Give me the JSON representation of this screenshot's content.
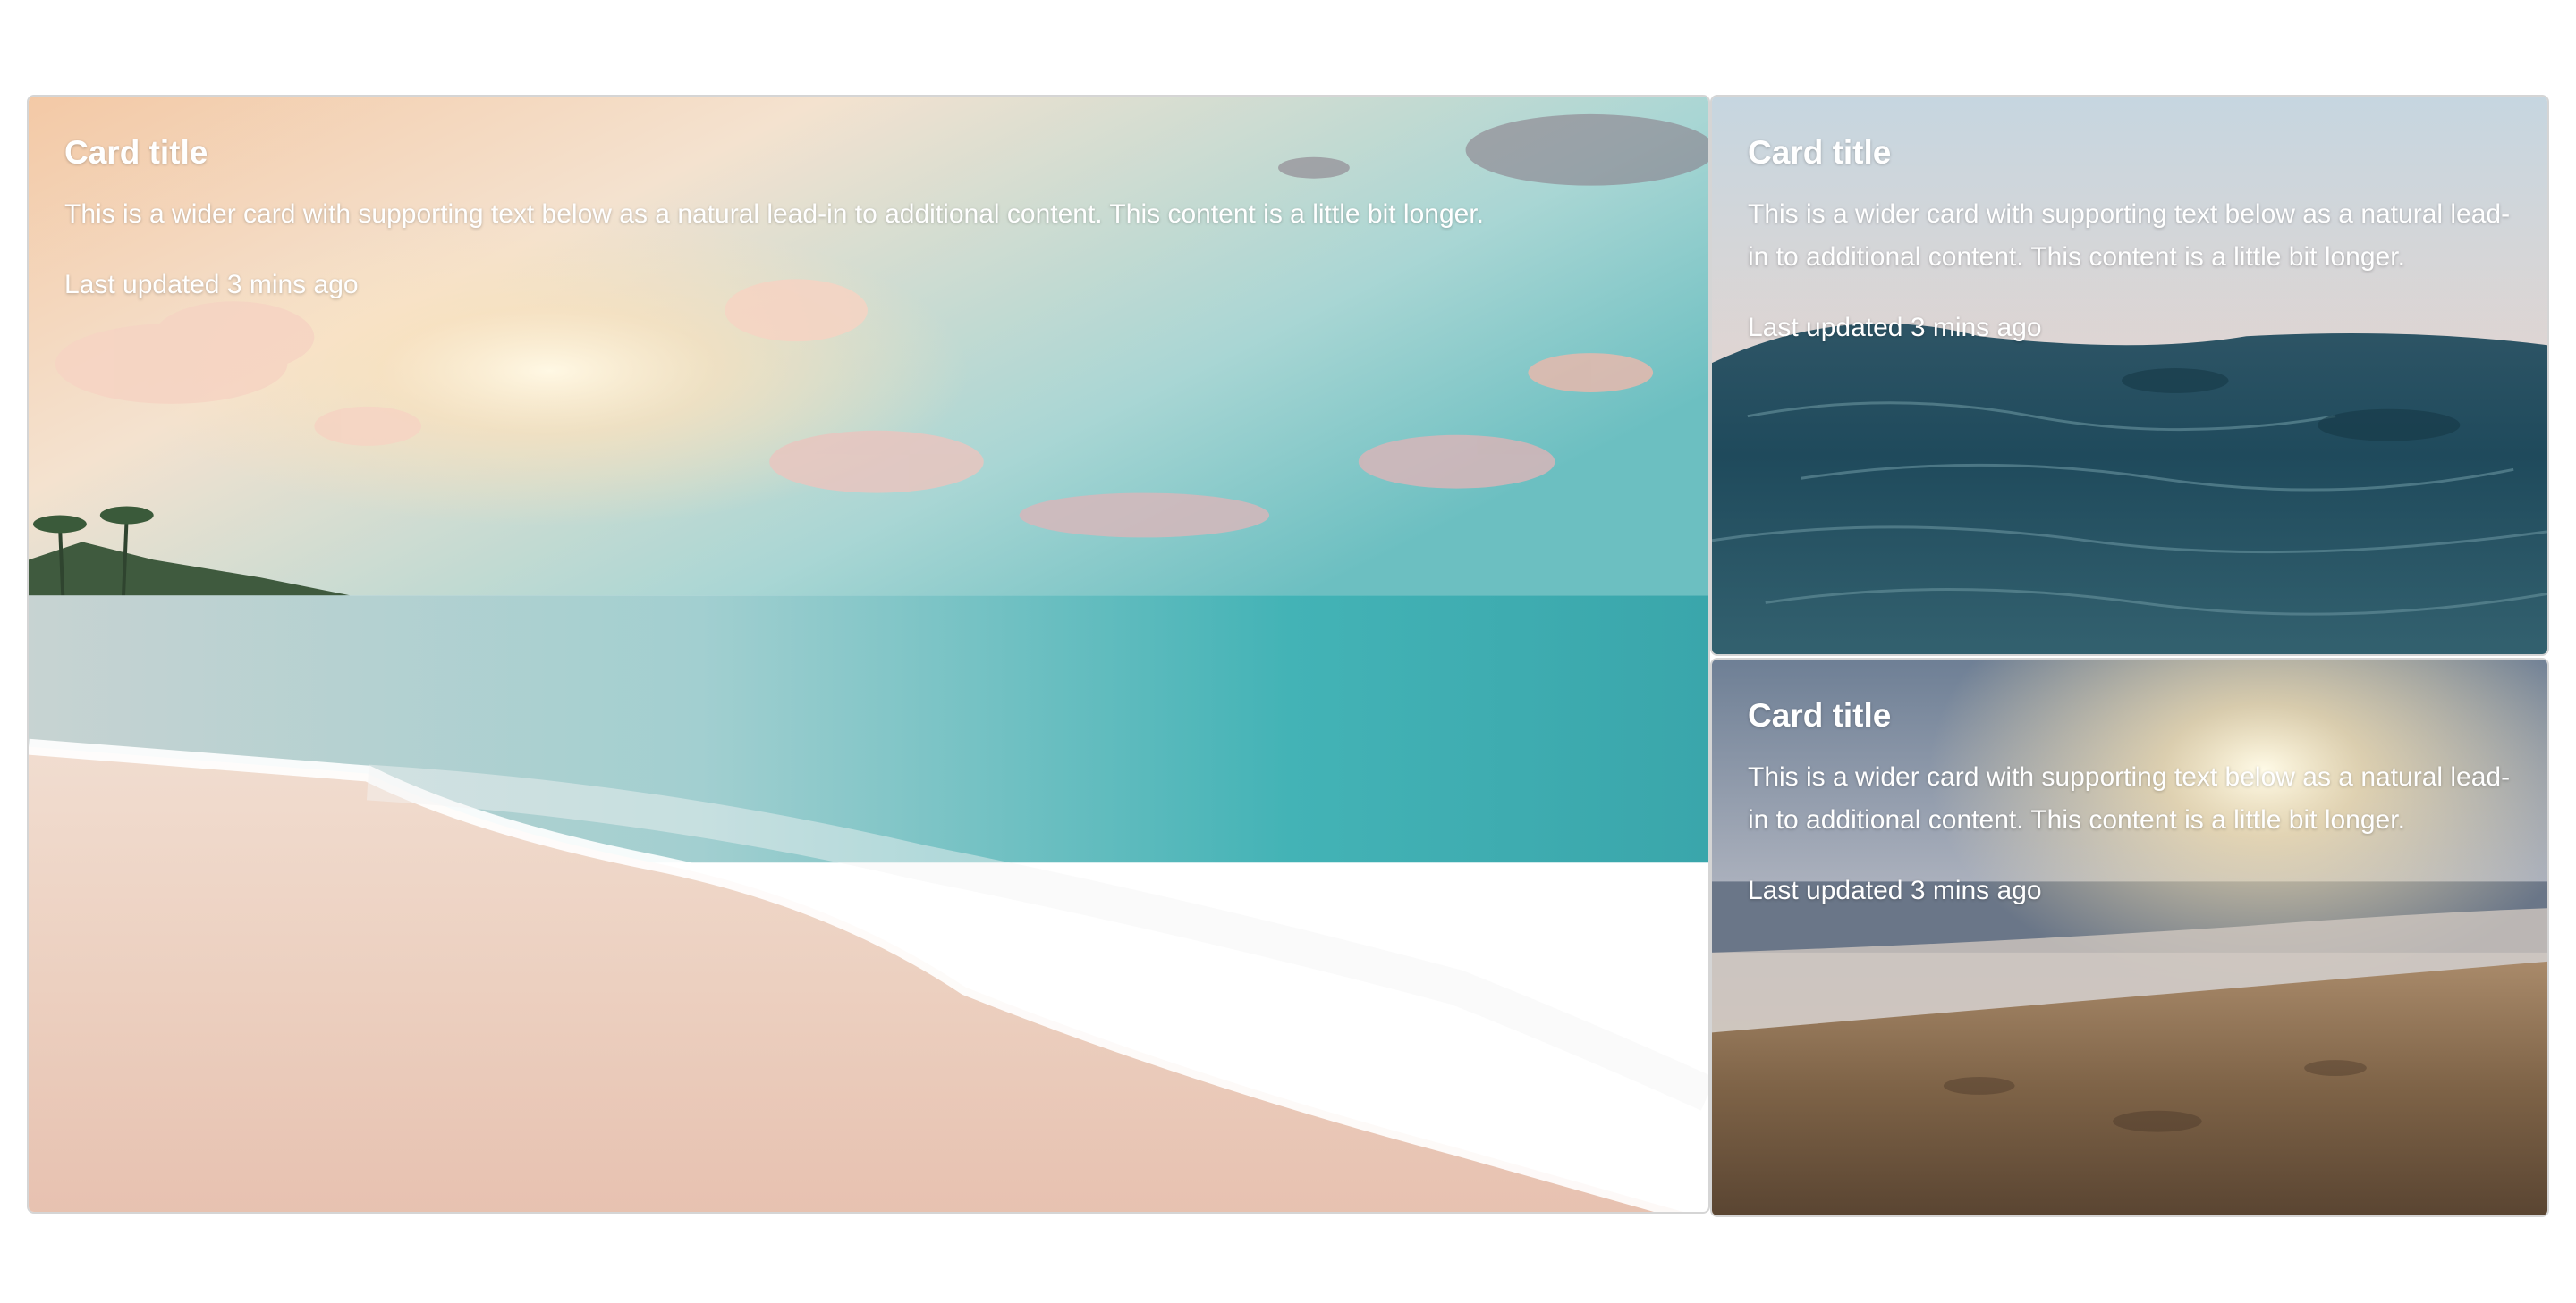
{
  "cards": [
    {
      "title": "Card title",
      "text": "This is a wider card with supporting text below as a natural lead-in to additional content. This content is a little bit longer.",
      "updated": "Last updated 3 mins ago",
      "image": "beach-sunset-waves"
    },
    {
      "title": "Card title",
      "text": "This is a wider card with supporting text below as a natural lead-in to additional content. This content is a little bit longer.",
      "updated": "Last updated 3 mins ago",
      "image": "ocean-water-closeup"
    },
    {
      "title": "Card title",
      "text": "This is a wider card with supporting text below as a natural lead-in to additional content. This content is a little bit longer.",
      "updated": "Last updated 3 mins ago",
      "image": "sandy-beach-sunrise"
    }
  ]
}
